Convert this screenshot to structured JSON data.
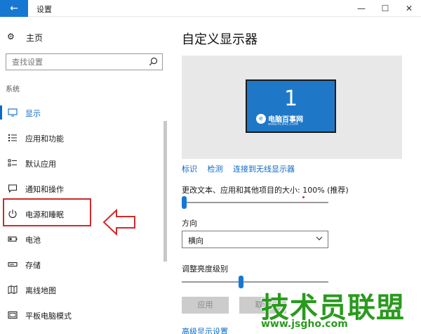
{
  "window": {
    "title": "设置",
    "back_glyph": "←",
    "minimize_glyph": "—",
    "maximize_glyph": "☐",
    "close_glyph": "✕"
  },
  "sidebar": {
    "home_label": "主页",
    "search_placeholder": "查找设置",
    "group_label": "系统",
    "items": [
      {
        "label": "显示",
        "icon": "monitor-icon",
        "active": true
      },
      {
        "label": "应用和功能",
        "icon": "list-icon"
      },
      {
        "label": "默认应用",
        "icon": "default-apps-icon"
      },
      {
        "label": "通知和操作",
        "icon": "notification-icon"
      },
      {
        "label": "电源和睡眠",
        "icon": "power-icon"
      },
      {
        "label": "电池",
        "icon": "battery-icon"
      },
      {
        "label": "存储",
        "icon": "storage-icon"
      },
      {
        "label": "离线地图",
        "icon": "map-icon"
      },
      {
        "label": "平板电脑模式",
        "icon": "tablet-icon"
      }
    ]
  },
  "main": {
    "heading": "自定义显示器",
    "monitor_number": "1",
    "watermark_text": "电脑百事网",
    "watermark_url": "www.PC841.COM",
    "links": [
      "标识",
      "检测",
      "连接到无线显示器"
    ],
    "scale_label": "更改文本、应用和其他项目的大小: 100% (推荐)",
    "scale_value_percent": 0,
    "orientation_label": "方向",
    "orientation_value": "横向",
    "brightness_label": "调整亮度级别",
    "brightness_value_percent": 40,
    "apply_label": "应用",
    "cancel_label": "取消",
    "advanced_link": "高级显示设置"
  },
  "watermark": {
    "brand": "技术员联盟",
    "url": "www.jsgho.com"
  },
  "colors": {
    "accent": "#0b69c7",
    "highlight_box": "#cf2a2a",
    "brand_green": "#2a9a1e"
  }
}
